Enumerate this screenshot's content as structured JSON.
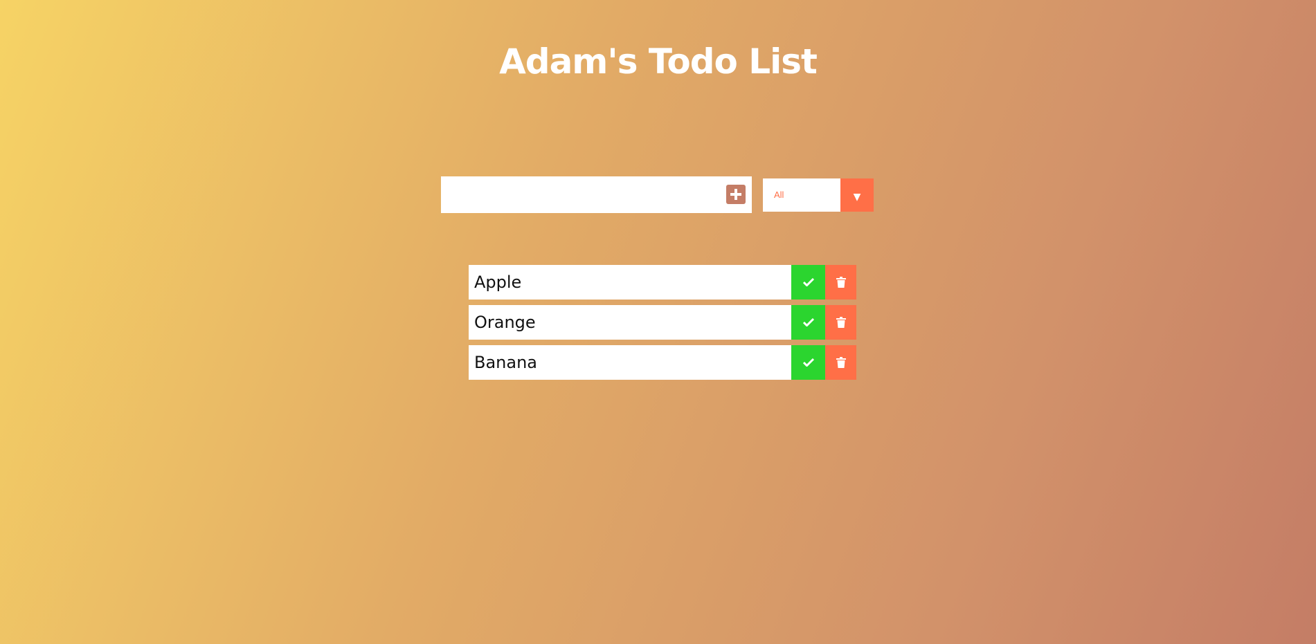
{
  "app": {
    "title": "Adam's Todo List"
  },
  "form": {
    "input_value": "",
    "input_placeholder": "",
    "add_icon": "plus-square-icon",
    "filter": {
      "selected": "All",
      "arrow": "▼"
    }
  },
  "todos": [
    {
      "text": "Apple"
    },
    {
      "text": "Orange"
    },
    {
      "text": "Banana"
    }
  ],
  "icons": {
    "complete": "check-icon",
    "delete": "trash-icon"
  },
  "colors": {
    "accent": "#ff6f47",
    "complete": "#2bd52f",
    "add_button": "#c47d66",
    "gradient_start": "#f6d365",
    "gradient_end": "#c47d66"
  }
}
